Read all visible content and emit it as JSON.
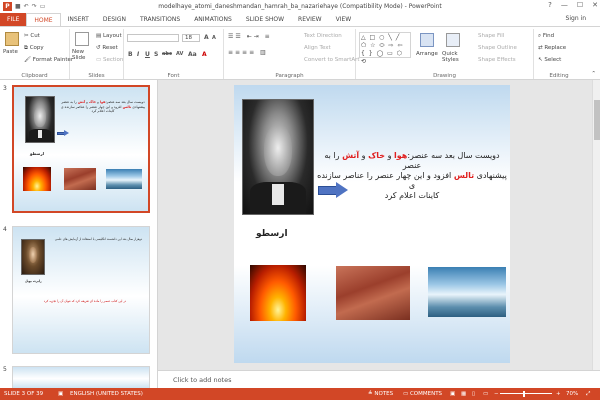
{
  "app": {
    "title": "modelhaye_atomi_daneshmandan_hamrah_ba_nazariehaye (Compatibility Mode) - PowerPoint",
    "brand_color": "#d24726",
    "sign_in": "Sign in",
    "qa_icons": [
      "save-icon",
      "undo-icon",
      "redo-icon",
      "start-slideshow-icon"
    ],
    "window_buttons": [
      "?",
      "—",
      "☐",
      "✕"
    ]
  },
  "tabs": [
    {
      "label": "FILE",
      "state": "file"
    },
    {
      "label": "HOME",
      "state": "active"
    },
    {
      "label": "INSERT",
      "state": ""
    },
    {
      "label": "DESIGN",
      "state": ""
    },
    {
      "label": "TRANSITIONS",
      "state": ""
    },
    {
      "label": "ANIMATIONS",
      "state": ""
    },
    {
      "label": "SLIDE SHOW",
      "state": ""
    },
    {
      "label": "REVIEW",
      "state": ""
    },
    {
      "label": "VIEW",
      "state": ""
    }
  ],
  "ribbon": {
    "clipboard": {
      "paste": "Paste",
      "cut": "Cut",
      "copy": "Copy",
      "format_painter": "Format Painter",
      "label": "Clipboard"
    },
    "slides": {
      "new_slide": "New Slide",
      "layout": "Layout",
      "reset": "Reset",
      "section": "Section",
      "label": "Slides"
    },
    "font": {
      "font_name": "",
      "font_size": "18",
      "label": "Font",
      "buttons": [
        "B",
        "I",
        "U",
        "S",
        "abc",
        "AV",
        "Aa",
        "A"
      ]
    },
    "paragraph": {
      "text_direction": "Text Direction",
      "align_text": "Align Text",
      "convert_smartart": "Convert to SmartArt",
      "label": "Paragraph"
    },
    "drawing": {
      "shapes": "△ □ ○ ╲ ╱ ⬠ ☆ ⬭ ⇨ ⇦ { } ◯ ▭ ⬡ ⟲",
      "arrange": "Arrange",
      "quick_styles": "Quick Styles",
      "shape_fill": "Shape Fill",
      "shape_outline": "Shape Outline",
      "shape_effects": "Shape Effects",
      "label": "Drawing"
    },
    "editing": {
      "find": "Find",
      "replace": "Replace",
      "select": "Select",
      "label": "Editing"
    }
  },
  "thumbnails": [
    {
      "number": "3"
    },
    {
      "number": "4"
    },
    {
      "number": "5"
    }
  ],
  "slide": {
    "text_line1_pre": "دویست سال بعد سه عنصر:",
    "water": "هوا",
    "and1": " و ",
    "earth": "خاک",
    "and2": " و ",
    "fire": "آتش",
    "text_line1_post": " را به عنصر",
    "text_line2_pre": "پیشنهادی ",
    "thales": "تالس",
    "text_line2_post": " افزود و این چهار عنصر را عناصر سازنده ی",
    "text_line3": "کاینات اعلام کرد",
    "caption": "ارسطو"
  },
  "thumb4": {
    "text1": "دوهزار سال بعد این دانشمند انگلیسی با استفاده از آزمایش های علمی",
    "text2": "در این کتاب عنصر را ماده ای تعریف کرد که نتوان آن را تجزیه کرد",
    "caption": "رابرت بویل"
  },
  "notes": {
    "placeholder": "Click to add notes"
  },
  "status": {
    "slide_info": "SLIDE 3 OF 39",
    "language": "ENGLISH (UNITED STATES)",
    "notes": "NOTES",
    "comments": "COMMENTS",
    "zoom": "70%",
    "zoom_fraction": 0.47
  }
}
